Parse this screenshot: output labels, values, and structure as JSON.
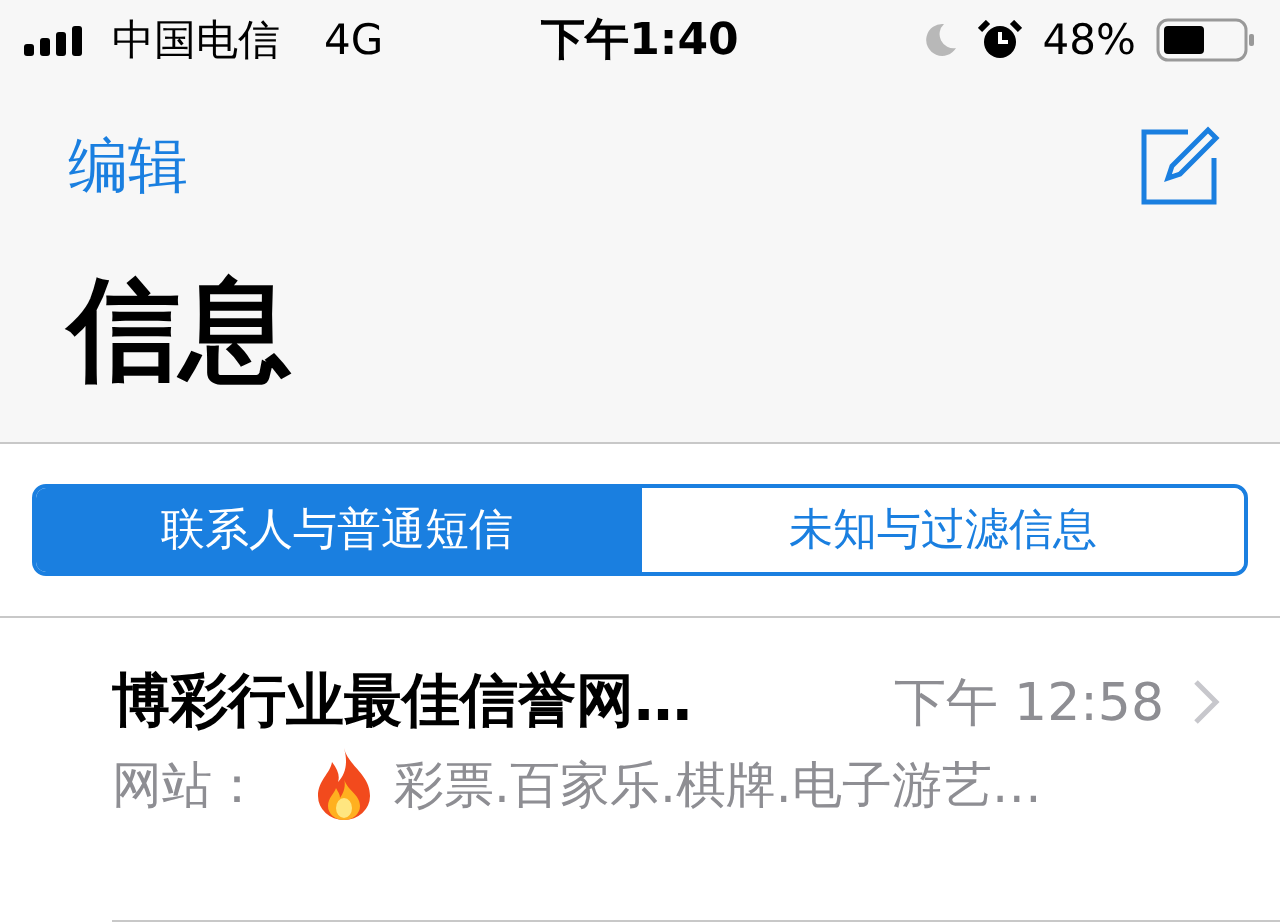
{
  "status_bar": {
    "carrier": "中国电信",
    "network": "4G",
    "time": "下午1:40",
    "battery": "48%"
  },
  "nav": {
    "edit": "编辑",
    "title": "信息"
  },
  "segments": [
    {
      "label": "联系人与普通短信",
      "selected": true
    },
    {
      "label": "未知与过滤信息",
      "selected": false
    }
  ],
  "messages": [
    {
      "sender": "博彩行业最佳信誉网…",
      "time": "下午 12:58",
      "preview_prefix": "网站：",
      "preview": "彩票.百家乐.棋牌.电子游艺…"
    }
  ]
}
